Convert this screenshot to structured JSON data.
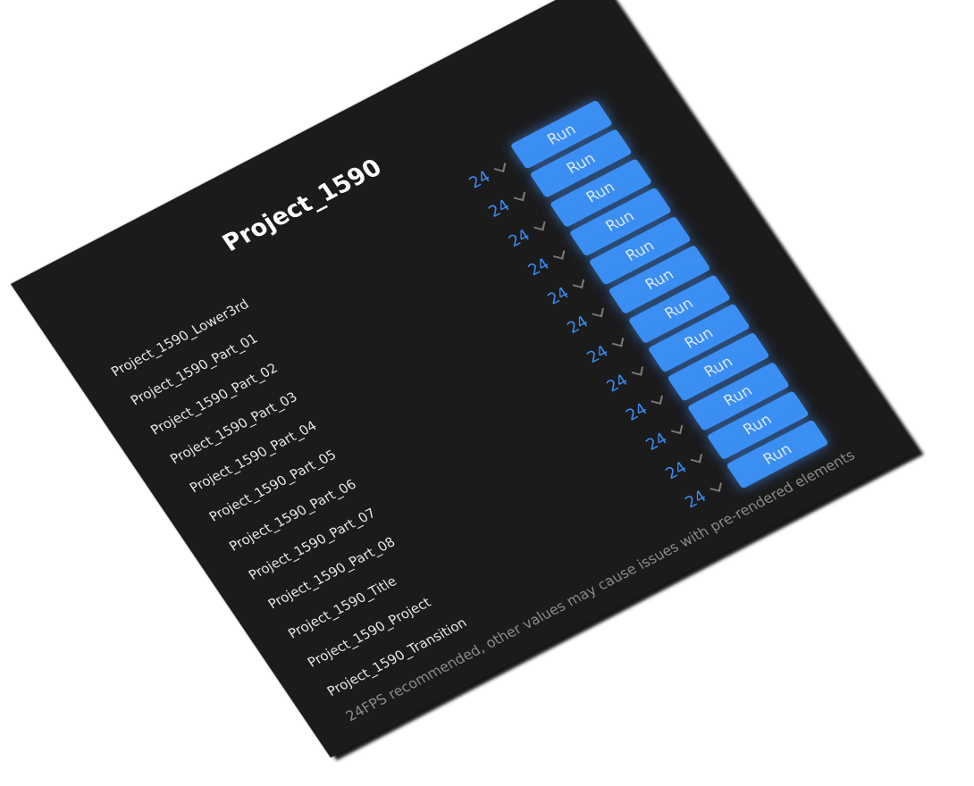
{
  "panel": {
    "title": "Project_1590",
    "note": "24FPS recommended, other values may cause issues with pre-rendered elements"
  },
  "rows": [
    {
      "name": "Project_1590_Lower3rd",
      "fps": "24",
      "action": "Run"
    },
    {
      "name": "Project_1590_Part_01",
      "fps": "24",
      "action": "Run"
    },
    {
      "name": "Project_1590_Part_02",
      "fps": "24",
      "action": "Run"
    },
    {
      "name": "Project_1590_Part_03",
      "fps": "24",
      "action": "Run"
    },
    {
      "name": "Project_1590_Part_04",
      "fps": "24",
      "action": "Run"
    },
    {
      "name": "Project_1590_Part_05",
      "fps": "24",
      "action": "Run"
    },
    {
      "name": "Project_1590_Part_06",
      "fps": "24",
      "action": "Run"
    },
    {
      "name": "Project_1590_Part_07",
      "fps": "24",
      "action": "Run"
    },
    {
      "name": "Project_1590_Part_08",
      "fps": "24",
      "action": "Run"
    },
    {
      "name": "Project_1590_Title",
      "fps": "24",
      "action": "Run"
    },
    {
      "name": "Project_1590_Project",
      "fps": "24",
      "action": "Run"
    },
    {
      "name": "Project_1590_Transition",
      "fps": "24",
      "action": "Run"
    }
  ],
  "colors": {
    "background": "#1b1b1c",
    "accent": "#3b8ef2",
    "fps_text": "#3a8cf0",
    "muted_text": "#8a8a8a"
  },
  "icons": {
    "fps_dropdown": "chevron-down-icon"
  }
}
